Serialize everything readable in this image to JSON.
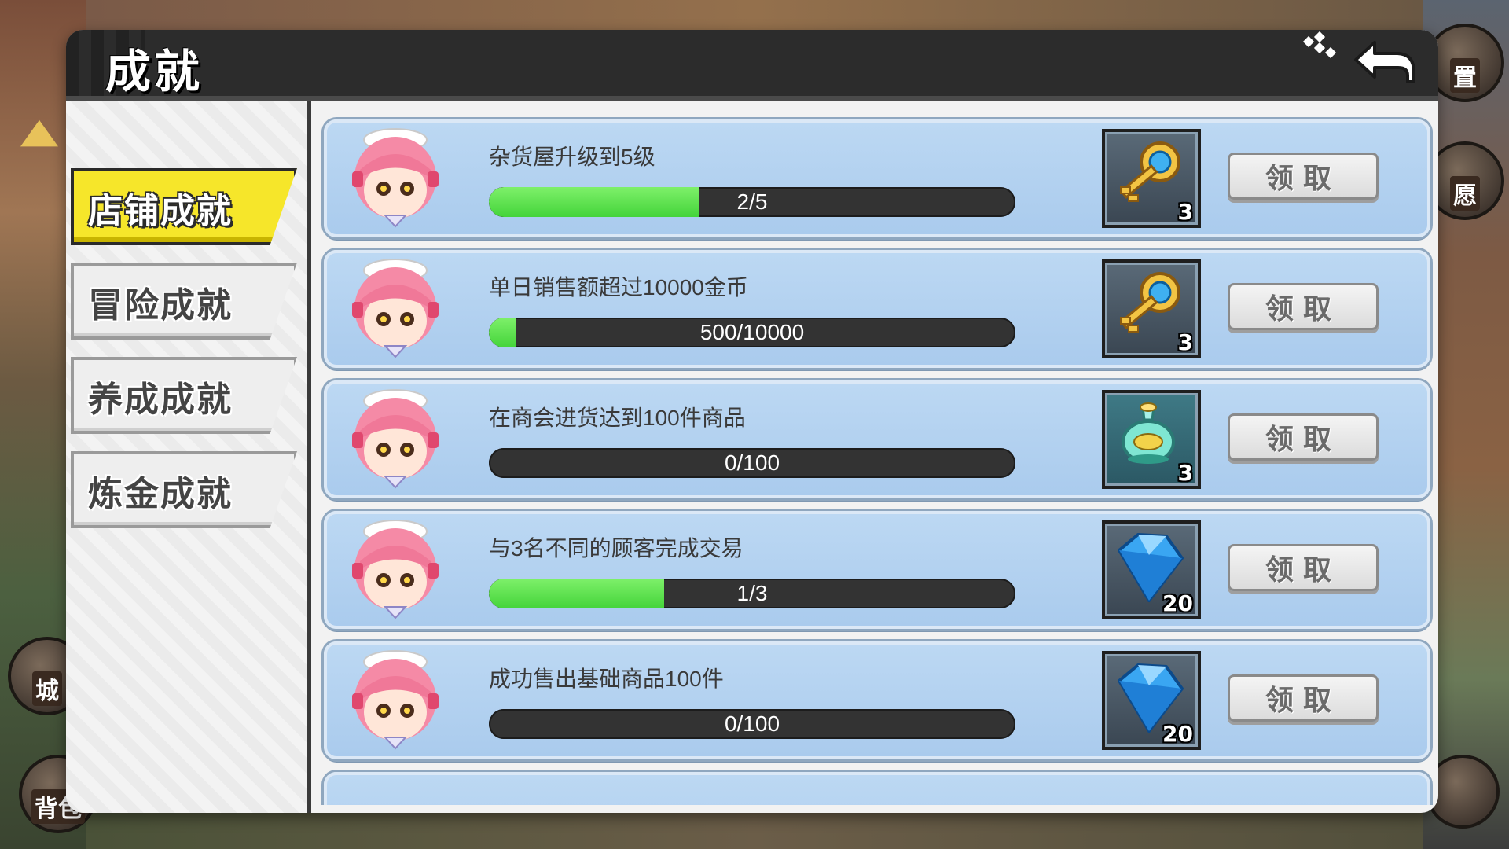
{
  "window": {
    "title": "成就",
    "close_icon": "return-arrow-icon"
  },
  "tabs": [
    {
      "label": "店铺成就",
      "active": true
    },
    {
      "label": "冒险成就",
      "active": false
    },
    {
      "label": "养成成就",
      "active": false
    },
    {
      "label": "炼金成就",
      "active": false
    }
  ],
  "achievements": [
    {
      "text": "杂货屋升级到5级",
      "progress": "2/5",
      "fraction": 0.4,
      "reward_icon": "gold-key-icon",
      "reward_count": "3",
      "claim_label": "领取"
    },
    {
      "text": "单日销售额超过10000金币",
      "progress": "500/10000",
      "fraction": 0.05,
      "reward_icon": "gold-key-icon",
      "reward_count": "3",
      "claim_label": "领取"
    },
    {
      "text": "在商会进货达到100件商品",
      "progress": "0/100",
      "fraction": 0,
      "reward_icon": "potion-bottle-icon",
      "reward_count": "3",
      "claim_label": "领取"
    },
    {
      "text": "与3名不同的顾客完成交易",
      "progress": "1/3",
      "fraction": 0.333,
      "reward_icon": "blue-diamond-icon",
      "reward_count": "20",
      "claim_label": "领取"
    },
    {
      "text": "成功售出基础商品100件",
      "progress": "0/100",
      "fraction": 0,
      "reward_icon": "blue-diamond-icon",
      "reward_count": "20",
      "claim_label": "领取"
    }
  ],
  "background": {
    "side_buttons": [
      {
        "label": "置"
      },
      {
        "label": "愿"
      },
      {
        "label": "城"
      },
      {
        "label": "背包"
      }
    ]
  },
  "colors": {
    "progress_fill": "#44d43a",
    "active_tab": "#f6e62a",
    "card_bg": "#aacbed"
  }
}
